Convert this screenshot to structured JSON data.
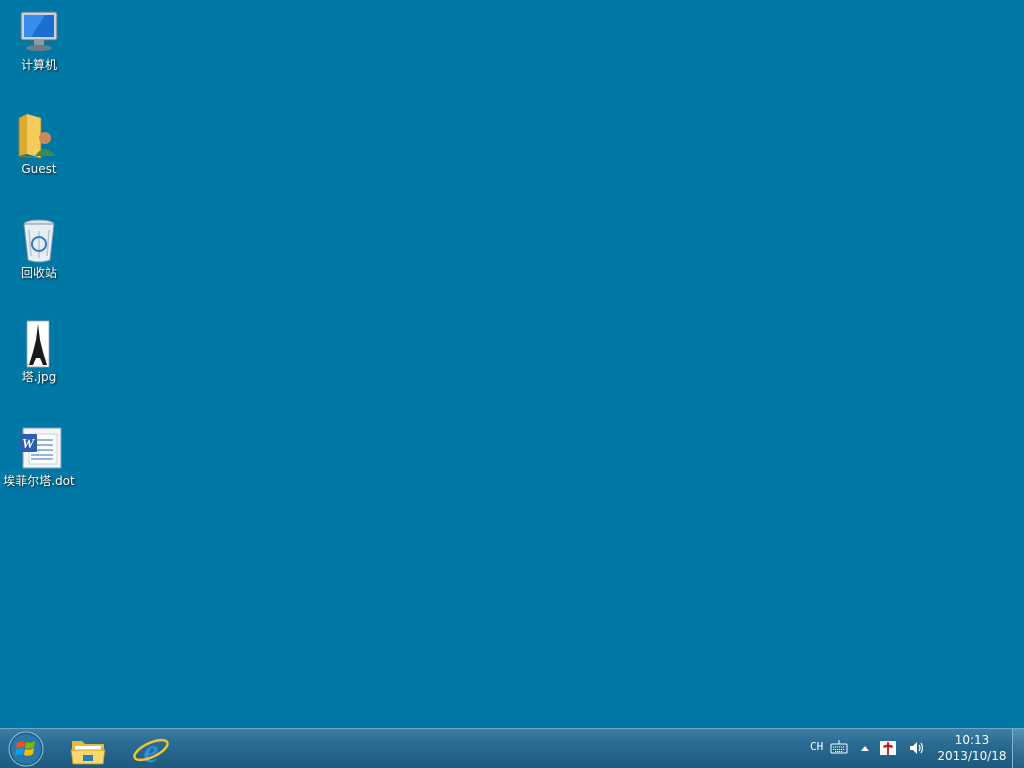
{
  "desktop": {
    "background_color": "#0078a6",
    "icons": [
      {
        "label": "计算机",
        "icon": "computer-icon"
      },
      {
        "label": "Guest",
        "icon": "user-folder-icon"
      },
      {
        "label": "回收站",
        "icon": "recycle-bin-icon"
      },
      {
        "label": "塔.jpg",
        "icon": "image-file-icon"
      },
      {
        "label": "埃菲尔塔.dot",
        "icon": "word-document-icon"
      }
    ]
  },
  "taskbar": {
    "start_icon": "windows-logo-icon",
    "pinned": [
      {
        "icon": "file-explorer-icon"
      },
      {
        "icon": "internet-explorer-icon"
      }
    ],
    "tray": {
      "language": "CH",
      "time": "10:13",
      "date": "2013/10/18"
    }
  }
}
